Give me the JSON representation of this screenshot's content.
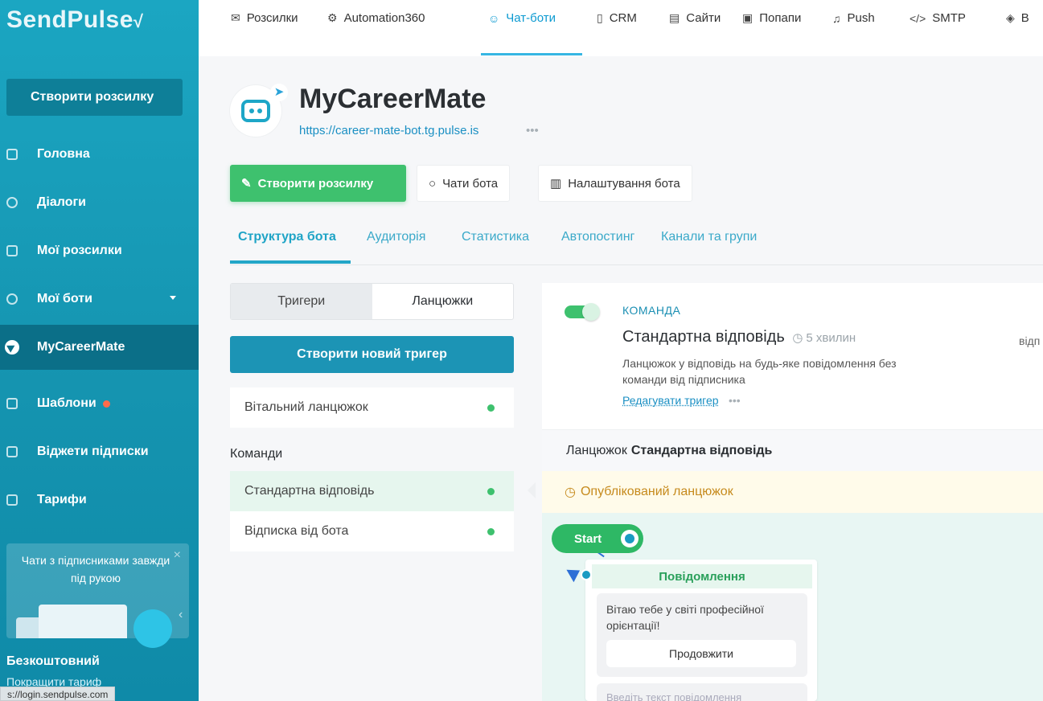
{
  "sidebar": {
    "logo": "SendPulse",
    "create_button": "Створити розсилку",
    "items": [
      {
        "label": "Головна",
        "icon": "home-icon"
      },
      {
        "label": "Діалоги",
        "icon": "chat-icon"
      },
      {
        "label": "Мої розсилки",
        "icon": "mail-icon"
      },
      {
        "label": "Мої боти",
        "icon": "bot-icon"
      },
      {
        "label": "MyCareerMate",
        "icon": "telegram-icon"
      },
      {
        "label": "Шаблони",
        "icon": "template-icon"
      },
      {
        "label": "Віджети підписки",
        "icon": "widget-icon"
      },
      {
        "label": "Тарифи",
        "icon": "card-icon"
      }
    ],
    "promo_text": "Чати з підписниками завжди під рукою",
    "plan": "Безкоштовний",
    "upgrade": "Покращити тариф",
    "status_url": "s://login.sendpulse.com"
  },
  "topnav": {
    "items": [
      "Розсилки",
      "Automation360",
      "Чат-боти",
      "CRM",
      "Сайти",
      "Попапи",
      "Push",
      "SMTP",
      "В"
    ],
    "active": "Чат-боти"
  },
  "bot": {
    "name": "MyCareerMate",
    "url": "https://career-mate-bot.tg.pulse.is",
    "dots": "•••"
  },
  "actions": {
    "create": "Створити розсилку",
    "chats": "Чати бота",
    "settings": "Налаштування бота"
  },
  "tabs": [
    "Структура бота",
    "Аудиторія",
    "Статистика",
    "Автопостинг",
    "Канали та групи"
  ],
  "left": {
    "seg": [
      "Тригери",
      "Ланцюжки"
    ],
    "new_trigger": "Створити новий тригер",
    "welcome": "Вітальний ланцюжок",
    "commands_label": "Команди",
    "commands": [
      "Стандартна відповідь",
      "Відписка від бота"
    ]
  },
  "right": {
    "label": "КОМАНДА",
    "title": "Стандартна відповідь",
    "time": "5 хвилин",
    "side": "відп",
    "desc": "Ланцюжок у відповідь на будь-яке повідомлення без команди від підписника",
    "edit": "Редагувати тригер",
    "chain_prefix": "Ланцюжок",
    "chain_name": "Стандартна відповідь",
    "published": "Опублікований ланцюжок",
    "start": "Start",
    "msg_header": "Повідомлення",
    "msg_text": "Вітаю тебе у світі професійної орієнтації!",
    "msg_button": "Продовжити",
    "msg_placeholder": "Введіть текст повідомлення"
  }
}
